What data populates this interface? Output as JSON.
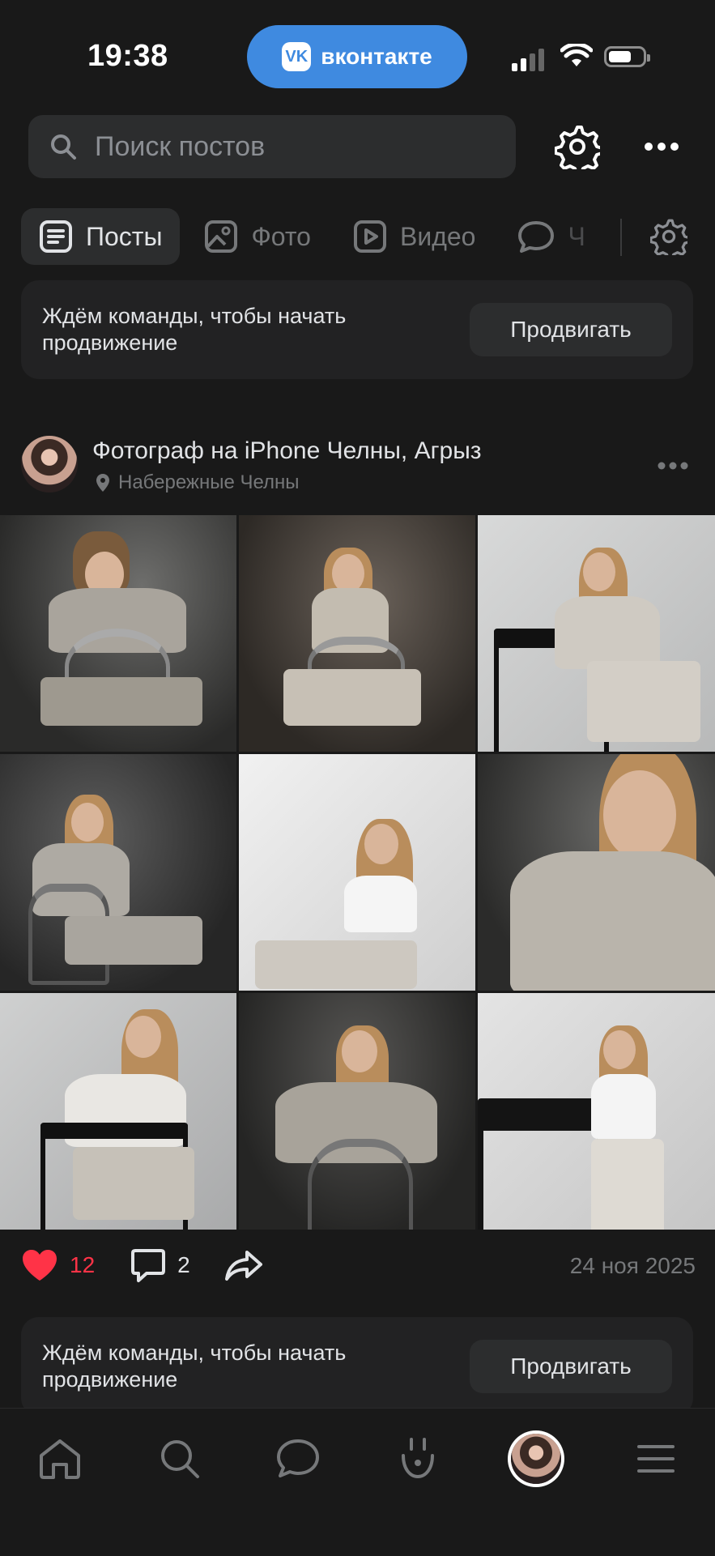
{
  "status_bar": {
    "time": "19:38",
    "app_pill": "вконтакте",
    "app_logo": "VK"
  },
  "search": {
    "placeholder": "Поиск постов"
  },
  "tabs": [
    {
      "label": "Посты",
      "icon": "posts-icon",
      "active": true
    },
    {
      "label": "Фото",
      "icon": "photo-icon",
      "active": false
    },
    {
      "label": "Видео",
      "icon": "video-icon",
      "active": false
    },
    {
      "label": "Ч",
      "icon": "chat-icon",
      "active": false
    }
  ],
  "promo_top": {
    "text": "Ждём команды, чтобы начать продвижение",
    "button": "Продвигать"
  },
  "post": {
    "author": "Фотограф на iPhone Челны, Агрыз",
    "location": "Набережные Челны",
    "likes": "12",
    "comments": "2",
    "date": "24 ноя 2025",
    "photo_count": 9
  },
  "promo_bottom": {
    "text": "Ждём команды, чтобы начать продвижение",
    "button": "Продвигать"
  },
  "bottom_nav": [
    "home-icon",
    "search-icon",
    "messages-icon",
    "clips-icon",
    "profile-avatar",
    "menu-icon"
  ],
  "colors": {
    "accent": "#3f8ae0",
    "like": "#ff3347",
    "background": "#191919"
  }
}
